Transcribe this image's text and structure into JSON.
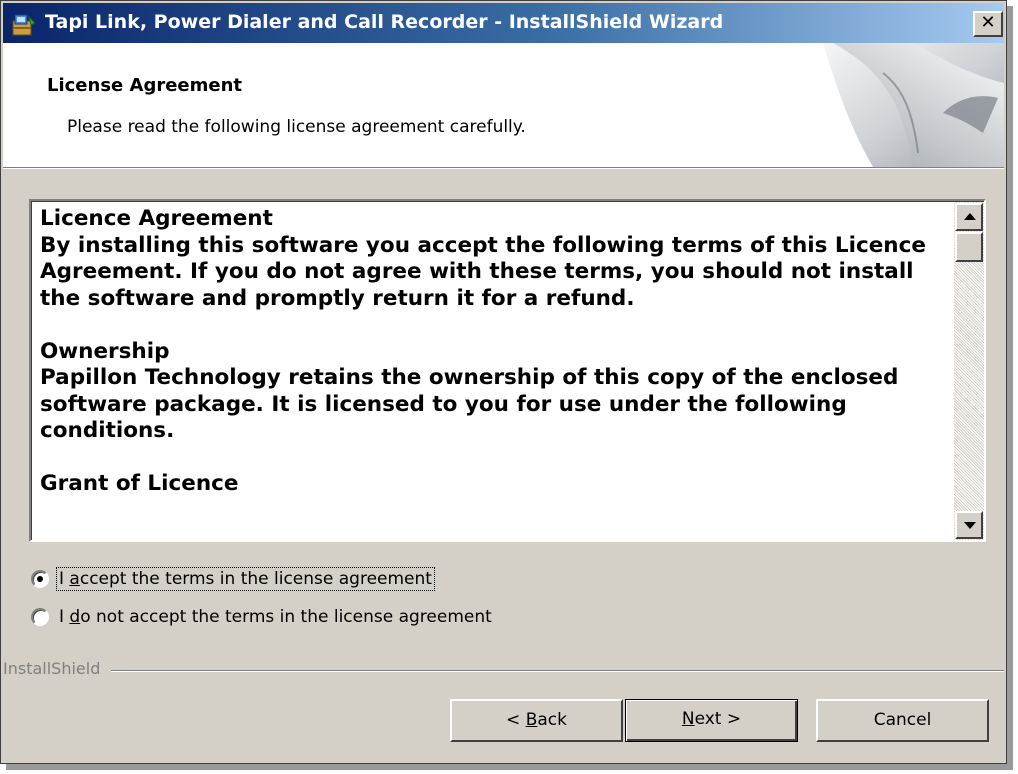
{
  "window": {
    "title": "Tapi Link, Power Dialer and Call Recorder - InstallShield Wizard",
    "close_glyph": "✕"
  },
  "header": {
    "title": "License Agreement",
    "subtitle": "Please read the following license agreement carefully."
  },
  "license": {
    "paragraphs": [
      [
        "Licence Agreement",
        "By installing this software you accept the following terms of this Licence Agreement. If you do not agree with these terms, you should not install the software and promptly return it for a refund."
      ],
      [
        "Ownership",
        "Papillon Technology retains the ownership of this copy of the enclosed software package. It is licensed to you for use under the following conditions."
      ],
      [
        "Grant of Licence",
        ""
      ]
    ]
  },
  "radios": {
    "accept": {
      "prefix": "I ",
      "mnemonic": "a",
      "suffix": "ccept the terms in the license agreement",
      "selected": true
    },
    "decline": {
      "prefix": "I ",
      "mnemonic": "d",
      "suffix": "o not accept the terms in the license agreement",
      "selected": false
    }
  },
  "footer": {
    "brand": "InstallShield"
  },
  "buttons": {
    "back": {
      "prefix": "< ",
      "mnemonic": "B",
      "suffix": "ack"
    },
    "next": {
      "prefix": "",
      "mnemonic": "N",
      "suffix": "ext >"
    },
    "cancel": {
      "label": "Cancel"
    }
  },
  "colors": {
    "titlebar_start": "#0a246a",
    "titlebar_end": "#a6caf0",
    "face": "#d4d0c8"
  },
  "icons": {
    "app": "installer-icon",
    "close": "close-icon",
    "scroll_up": "arrow-up-icon",
    "scroll_down": "arrow-down-icon"
  }
}
